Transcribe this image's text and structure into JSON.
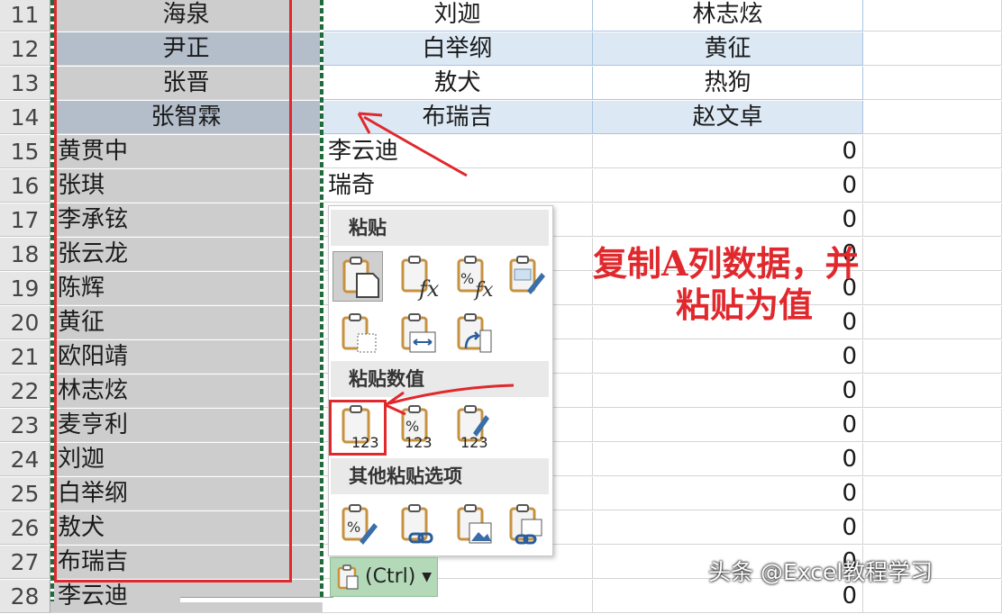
{
  "rows": [
    {
      "num": "11",
      "a": "海泉",
      "b": "刘迦",
      "c": "林志炫",
      "style": "top"
    },
    {
      "num": "12",
      "a": "尹正",
      "b": "白举纲",
      "c": "黄征",
      "style": "hl"
    },
    {
      "num": "13",
      "a": "张晋",
      "b": "敖犬",
      "c": "热狗",
      "style": "top"
    },
    {
      "num": "14",
      "a": "张智霖",
      "b": "布瑞吉",
      "c": "赵文卓",
      "style": "hl"
    },
    {
      "num": "15",
      "a": "黄贯中",
      "b": "李云迪",
      "c": "0"
    },
    {
      "num": "16",
      "a": "张琪",
      "b": "瑞奇",
      "c": "0"
    },
    {
      "num": "17",
      "a": "李承铉",
      "b": "",
      "c": "0"
    },
    {
      "num": "18",
      "a": "张云龙",
      "b": "",
      "c": "0"
    },
    {
      "num": "19",
      "a": "陈辉",
      "b": "",
      "c": "0"
    },
    {
      "num": "20",
      "a": "黄征",
      "b": "",
      "c": "0"
    },
    {
      "num": "21",
      "a": "欧阳靖",
      "b": "",
      "c": "0"
    },
    {
      "num": "22",
      "a": "林志炫",
      "b": "",
      "c": "0"
    },
    {
      "num": "23",
      "a": "麦亨利",
      "b": "",
      "c": "0"
    },
    {
      "num": "24",
      "a": "刘迦",
      "b": "",
      "c": "0"
    },
    {
      "num": "25",
      "a": "白举纲",
      "b": "",
      "c": "0"
    },
    {
      "num": "26",
      "a": "敖犬",
      "b": "",
      "c": "0"
    },
    {
      "num": "27",
      "a": "布瑞吉",
      "b": "",
      "c": "0"
    },
    {
      "num": "28",
      "a": "李云迪",
      "b": "",
      "c": "0"
    }
  ],
  "paste_menu": {
    "section_paste": "粘贴",
    "section_values": "粘贴数值",
    "section_other": "其他粘贴选项",
    "num_label": "123"
  },
  "ctrl_button": {
    "label": "(Ctrl)"
  },
  "annotation": {
    "line1": "复制A列数据，并",
    "line2": "粘贴为值"
  },
  "watermark": "头条 @Excel教程学习",
  "colors": {
    "accent_red": "#e0282d",
    "march_green": "#1f6b3b",
    "ctrl_green": "#b3d9b8"
  }
}
